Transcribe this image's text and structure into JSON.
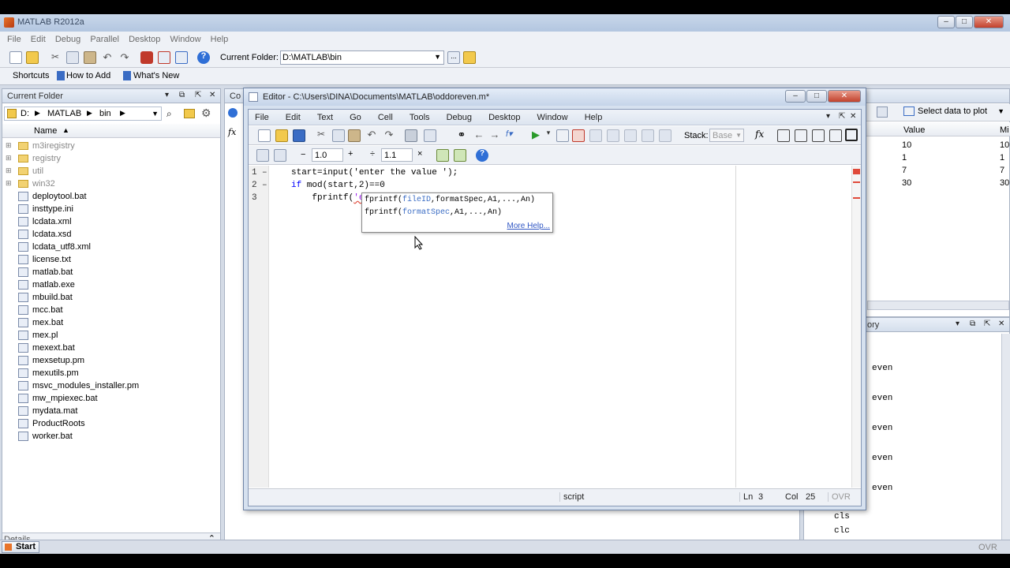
{
  "window": {
    "title": "MATLAB R2012a"
  },
  "menu": [
    "File",
    "Edit",
    "Debug",
    "Parallel",
    "Desktop",
    "Window",
    "Help"
  ],
  "toolbar": {
    "current_folder_label": "Current Folder:",
    "current_folder_value": "D:\\MATLAB\\bin"
  },
  "shortcuts": {
    "shortcuts_label": "Shortcuts",
    "how_to_add": "How to Add",
    "whats_new": "What's New"
  },
  "current_folder_panel": {
    "title": "Current Folder",
    "path": [
      "D:",
      "MATLAB",
      "bin"
    ],
    "column_name": "Name",
    "folders": [
      "m3iregistry",
      "registry",
      "util",
      "win32"
    ],
    "files": [
      "deploytool.bat",
      "insttype.ini",
      "lcdata.xml",
      "lcdata.xsd",
      "lcdata_utf8.xml",
      "license.txt",
      "matlab.bat",
      "matlab.exe",
      "mbuild.bat",
      "mcc.bat",
      "mex.bat",
      "mex.pl",
      "mexext.bat",
      "mexsetup.pm",
      "mexutils.pm",
      "msvc_modules_installer.pm",
      "mw_mpiexec.bat",
      "mydata.mat",
      "ProductRoots",
      "worker.bat"
    ],
    "details": "Details"
  },
  "workspace": {
    "select_data": "Select data to plot",
    "col_value": "Value",
    "col_m": "Mi",
    "rows": [
      {
        "value": "10",
        "min": "10"
      },
      {
        "value": "1",
        "min": "1"
      },
      {
        "value": "7",
        "min": "7"
      },
      {
        "value": "30",
        "min": "30"
      }
    ]
  },
  "history": {
    "title": "ory",
    "items": [
      "even",
      "even",
      "even",
      "even",
      "even"
    ],
    "cmds": [
      "cls",
      "clc"
    ]
  },
  "command_window": {
    "header": "Co"
  },
  "editor": {
    "title": "Editor - C:\\Users\\DINA\\Documents\\MATLAB\\oddoreven.m*",
    "menu": [
      "File",
      "Edit",
      "Text",
      "Go",
      "Cell",
      "Tools",
      "Debug",
      "Desktop",
      "Window",
      "Help"
    ],
    "stack_label": "Stack:",
    "stack_value": "Base",
    "cell_minus": "−",
    "cell_val1": "1.0",
    "cell_plus": "+",
    "cell_div": "÷",
    "cell_val2": "1.1",
    "cell_times": "×",
    "lines": [
      {
        "num": "1",
        "dash": "–",
        "code": "start=input('enter the value ');"
      },
      {
        "num": "2",
        "dash": "–",
        "code_kw": "if",
        "code_rest": " mod(start,2)==0"
      },
      {
        "num": "3",
        "dash": "",
        "code_pre": "    fprintf(",
        "code_str": "'even number"
      }
    ],
    "tooltip": {
      "line1": "fprintf(fileID,formatSpec,A1,...,An)",
      "line2": "fprintf(formatSpec,A1,...,An)",
      "more": "More Help..."
    },
    "status": {
      "type": "script",
      "ln_label": "Ln",
      "ln": "3",
      "col_label": "Col",
      "col": "25",
      "ovr": "OVR"
    }
  },
  "taskbar": {
    "start": "Start",
    "ovr": "OVR"
  }
}
